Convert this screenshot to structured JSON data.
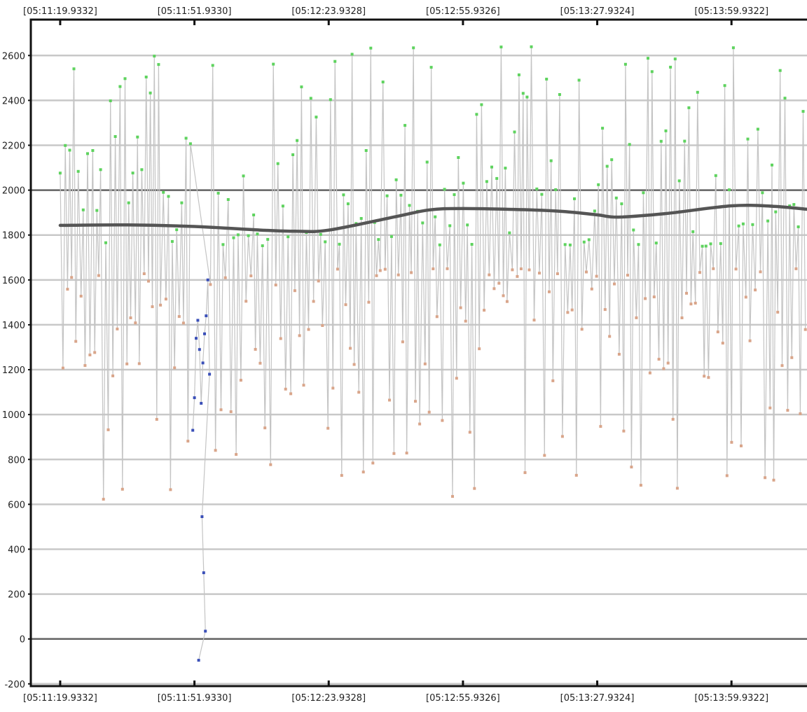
{
  "chart_data": {
    "type": "scatter",
    "title": "",
    "xlabel": "",
    "ylabel": "",
    "x_tick_labels": [
      "[05:11:19.9332]",
      "[05:11:51.9330]",
      "[05:12:23.9328]",
      "[05:12:55.9326]",
      "[05:13:27.9324]",
      "[05:13:59.9322]"
    ],
    "x_tick_seconds": [
      0,
      32,
      64,
      96,
      128,
      160
    ],
    "xlim": [
      -7,
      178
    ],
    "y_ticks": [
      -200,
      0,
      200,
      400,
      600,
      800,
      1000,
      1200,
      1400,
      1600,
      1800,
      2000,
      2200,
      2400,
      2600
    ],
    "ylim": [
      -210,
      2760
    ],
    "reference_lines": [
      0,
      2000
    ],
    "grid": true,
    "legend": "none",
    "colors": {
      "series_line": "#c4c4c4",
      "high_points": "#5ed35e",
      "low_points": "#d9a58a",
      "outlier_points": "#3a4fb8",
      "trend_line": "#555555",
      "reference_line": "#666666",
      "grid": "#c8c8c8",
      "axis": "#111111"
    },
    "trend_line": {
      "x": [
        0,
        16,
        32,
        48,
        56,
        64,
        80,
        88,
        96,
        112,
        120,
        128,
        133,
        144,
        160,
        170,
        178
      ],
      "y": [
        1843,
        1845,
        1838,
        1822,
        1817,
        1822,
        1882,
        1912,
        1918,
        1912,
        1905,
        1890,
        1880,
        1895,
        1930,
        1928,
        1915
      ]
    },
    "outlier_series": {
      "x": [
        31.6,
        32.0,
        32.4,
        32.8,
        33.2,
        33.6,
        34.0,
        34.4,
        34.8,
        35.2,
        35.6,
        33.8,
        34.2,
        34.6,
        33.0
      ],
      "y": [
        930,
        1075,
        1340,
        1420,
        1290,
        1050,
        1230,
        1360,
        1440,
        1600,
        1180,
        545,
        295,
        35,
        -95
      ]
    },
    "oscillation": {
      "x_start": 0,
      "x_end": 178,
      "cycle_seconds": 1.1,
      "high_band": [
        1750,
        2640
      ],
      "low_band": [
        620,
        1650
      ]
    }
  }
}
